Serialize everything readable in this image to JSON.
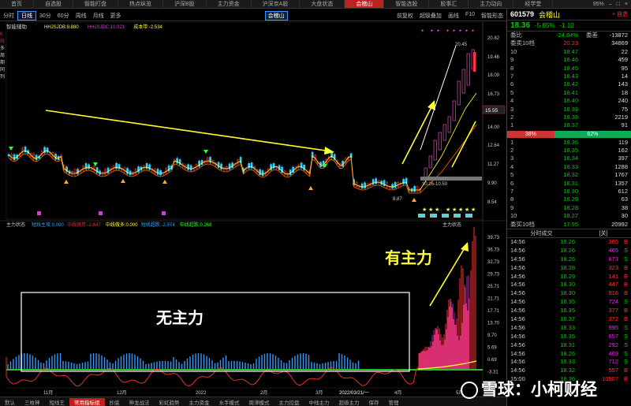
{
  "topbar": {
    "tabs": [
      "首页",
      "自选股",
      "智能盯盘",
      "热点纵览",
      "沪深B股",
      "主力资金",
      "沪深京A股",
      "大盘状态",
      "会稽山",
      "智能选股",
      "股事汇",
      "主力动向",
      "经学堂"
    ],
    "active_index": 8,
    "battery": "95%"
  },
  "toolbar": {
    "items": [
      "分时",
      "日线",
      "30分",
      "60分",
      "周线",
      "月线",
      "更多"
    ],
    "selected_index": 1,
    "stock": "会稽山",
    "right_items": [
      "前复权",
      "超级叠加",
      "画线",
      "F10",
      "智能形态"
    ]
  },
  "main_chart": {
    "legend_name": "智能辅助",
    "indicators": [
      {
        "label": "HHJSJDB:9.880",
        "color": "#ff3"
      },
      {
        "label": "HHJSJDC:10.021",
        "color": "#d3d"
      },
      {
        "label": "成本带:-2.534",
        "color": "#ff3"
      }
    ],
    "y_ticks": [
      "20.82",
      "19.46",
      "18.09",
      "16.73",
      "15.55",
      "14.00",
      "12.64",
      "11.27",
      "9.90",
      "8.54"
    ],
    "current_price_tag": "15.55",
    "high_label": "20.45",
    "low_label": "8.87",
    "range_label": "10.26-10.50"
  },
  "sub_chart": {
    "title": "主力状态",
    "indicators": [
      {
        "label": "短线主攻:0.000",
        "color": "#3af"
      },
      {
        "label": "中线强势:-2.647",
        "color": "#d33"
      },
      {
        "label": "中线做多:0.000",
        "color": "#ff3"
      },
      {
        "label": "短线超跌:-2.974",
        "color": "#3af"
      },
      {
        "label": "中线超跌:0.268",
        "color": "#3f3"
      }
    ],
    "title_right": "主力状态",
    "y_ticks": [
      "39.73",
      "36.73",
      "32.73",
      "29.73",
      "25.71",
      "21.71",
      "17.71",
      "13.70",
      "9.70",
      "5.69",
      "0.69",
      "-3.31"
    ],
    "annotation_none": "无主力",
    "annotation_have": "有主力",
    "x_ticks": [
      "11月",
      "12月",
      "2022",
      "2月",
      "3月",
      "2022/03/21/一",
      "4月",
      "5月"
    ]
  },
  "left_edge": [
    "K",
    "线",
    "多",
    "周",
    "期",
    "同",
    "列"
  ],
  "bottombar": {
    "items": [
      "默认",
      "三枚神",
      "短线王",
      "常用指标组",
      "抄底",
      "神龙战法",
      "彩虹趋势",
      "主力资金",
      "水手模式",
      "周津模式",
      "主力控盘",
      "中线主力",
      "超级主力",
      "保存",
      "管理"
    ],
    "selected_index": 3
  },
  "quote_panel": {
    "code": "601579",
    "name": "会稽山",
    "star": "+ 自选",
    "price": "18.36",
    "change_pct": "-5.65%",
    "change": "-1.10",
    "weibi_label": "委比",
    "weibi": "-24.84%",
    "weicha_label": "委差",
    "weicha": "-13872",
    "sell_header": "委卖10档",
    "sell_header_price": "20.23",
    "sell_header_vol": "34869",
    "asks": [
      [
        "10",
        "18.47",
        "22"
      ],
      [
        "9",
        "18.46",
        "459"
      ],
      [
        "8",
        "18.45",
        "95"
      ],
      [
        "7",
        "18.43",
        "14"
      ],
      [
        "6",
        "18.42",
        "143"
      ],
      [
        "5",
        "18.41",
        "18"
      ],
      [
        "4",
        "18.40",
        "240"
      ],
      [
        "3",
        "18.39",
        "75"
      ],
      [
        "2",
        "18.38",
        "2219"
      ],
      [
        "1",
        "18.37",
        "91"
      ]
    ],
    "ratio_red": "38%",
    "ratio_green": "62%",
    "bids": [
      [
        "1",
        "18.36",
        "119"
      ],
      [
        "2",
        "18.35",
        "162"
      ],
      [
        "3",
        "18.34",
        "397"
      ],
      [
        "4",
        "18.33",
        "1288"
      ],
      [
        "5",
        "18.32",
        "1767"
      ],
      [
        "6",
        "18.31",
        "1357"
      ],
      [
        "7",
        "18.30",
        "612"
      ],
      [
        "8",
        "18.29",
        "63"
      ],
      [
        "9",
        "18.28",
        "38"
      ],
      [
        "10",
        "18.27",
        "30"
      ]
    ],
    "buy_header": "委买10档",
    "buy_header_price": "17.95",
    "buy_header_vol": "20992",
    "ticks_tabs": [
      "分时成交",
      "[关]"
    ],
    "ticks": [
      [
        "14:56",
        "18.26",
        "385",
        "B"
      ],
      [
        "14:56",
        "18.26",
        "465",
        "S"
      ],
      [
        "14:56",
        "18.26",
        "673",
        "S"
      ],
      [
        "14:56",
        "18.28",
        "323",
        "B"
      ],
      [
        "14:56",
        "18.29",
        "141",
        "B"
      ],
      [
        "14:56",
        "18.30",
        "447",
        "B"
      ],
      [
        "14:56",
        "18.30",
        "916",
        "B"
      ],
      [
        "14:56",
        "18.35",
        "724",
        "S"
      ],
      [
        "14:56",
        "18.35",
        "377",
        "B"
      ],
      [
        "14:56",
        "18.37",
        "372",
        "B"
      ],
      [
        "14:56",
        "18.33",
        "995",
        "S"
      ],
      [
        "14:56",
        "18.35",
        "657",
        "S"
      ],
      [
        "14:56",
        "18.31",
        "292",
        "S"
      ],
      [
        "14:56",
        "18.26",
        "469",
        "S"
      ],
      [
        "14:56",
        "18.33",
        "712",
        "S"
      ],
      [
        "14:56",
        "18.32",
        "557",
        "B"
      ],
      [
        "15:00",
        "18.36",
        "10907",
        "B"
      ]
    ]
  },
  "watermark": "雪球：小柯财经"
}
